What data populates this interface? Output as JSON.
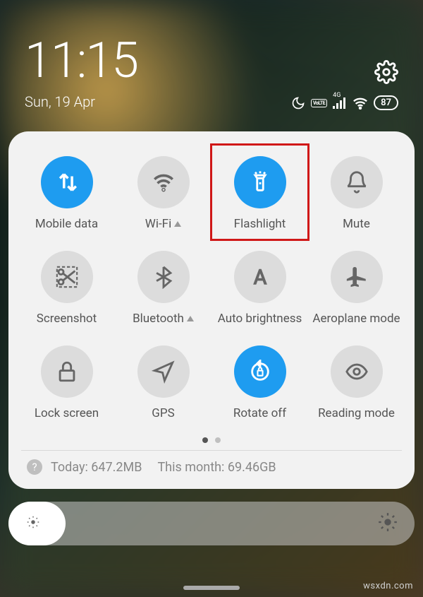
{
  "status": {
    "time": "11:15",
    "date": "Sun, 19 Apr",
    "network_type": "4G",
    "volte": "VoLTE",
    "battery": "87"
  },
  "tiles": [
    {
      "id": "mobile-data",
      "label": "Mobile data",
      "active": true,
      "icon": "data-arrows"
    },
    {
      "id": "wifi",
      "label": "Wi-Fi",
      "active": false,
      "icon": "wifi",
      "suffix": "tri"
    },
    {
      "id": "flashlight",
      "label": "Flashlight",
      "active": true,
      "icon": "flashlight",
      "highlight": true
    },
    {
      "id": "mute",
      "label": "Mute",
      "active": false,
      "icon": "bell"
    },
    {
      "id": "screenshot",
      "label": "Screenshot",
      "active": false,
      "icon": "scissors"
    },
    {
      "id": "bluetooth",
      "label": "Bluetooth",
      "active": false,
      "icon": "bluetooth",
      "suffix": "tri"
    },
    {
      "id": "auto-brightness",
      "label": "Auto brightness",
      "active": false,
      "icon": "letter-a"
    },
    {
      "id": "aeroplane",
      "label": "Aeroplane mode",
      "active": false,
      "icon": "plane"
    },
    {
      "id": "lock-screen",
      "label": "Lock screen",
      "active": false,
      "icon": "lock"
    },
    {
      "id": "gps",
      "label": "GPS",
      "active": false,
      "icon": "nav-arrow"
    },
    {
      "id": "rotate",
      "label": "Rotate off",
      "active": true,
      "icon": "rotate-lock"
    },
    {
      "id": "reading",
      "label": "Reading mode",
      "active": false,
      "icon": "eye"
    }
  ],
  "pager": {
    "total": 2,
    "active": 0
  },
  "usage": {
    "today_label": "Today:",
    "today_val": "647.2MB",
    "month_label": "This month:",
    "month_val": "69.46GB"
  },
  "brightness": {
    "level_pct": 14
  },
  "watermark": "wsxdn.com",
  "colors": {
    "accent": "#1e9cf0",
    "highlight": "#d01818"
  }
}
